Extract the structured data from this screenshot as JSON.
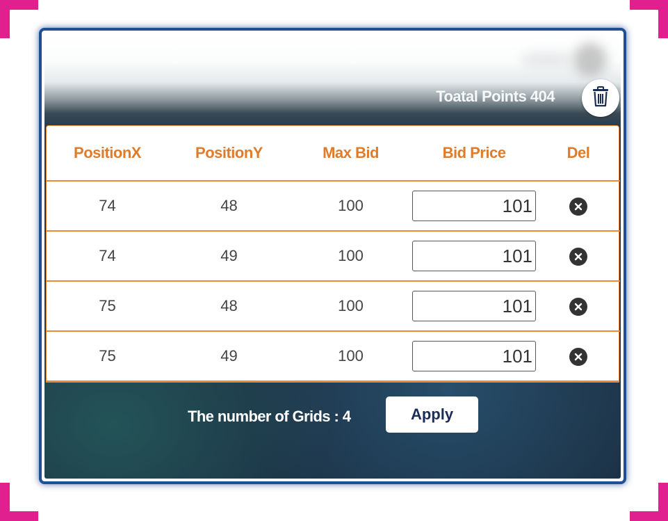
{
  "header": {
    "total_points": "Toatal Points 404"
  },
  "table": {
    "columns": [
      "PositionX",
      "PositionY",
      "Max Bid",
      "Bid Price",
      "Del"
    ],
    "rows": [
      {
        "x": "74",
        "y": "48",
        "max_bid": "100",
        "bid_price": "101"
      },
      {
        "x": "74",
        "y": "49",
        "max_bid": "100",
        "bid_price": "101"
      },
      {
        "x": "75",
        "y": "48",
        "max_bid": "100",
        "bid_price": "101"
      },
      {
        "x": "75",
        "y": "49",
        "max_bid": "100",
        "bid_price": "101"
      }
    ]
  },
  "footer": {
    "grid_count_label": "The number of Grids : 4",
    "apply_label": "Apply"
  },
  "icons": {
    "trash": "trash-icon",
    "delete_row": "close-circle-icon"
  },
  "colors": {
    "accent_orange": "#e07b2a",
    "frame_blue": "#1d4f92",
    "corner_pink": "#e0208f",
    "button_text": "#1c2d55"
  }
}
